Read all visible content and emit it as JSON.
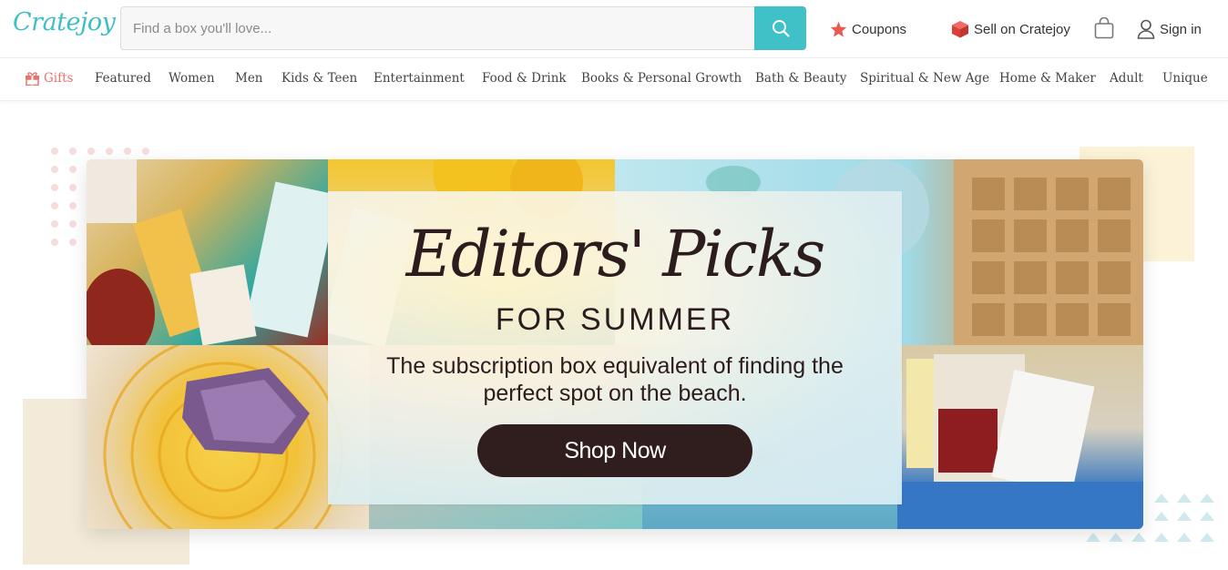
{
  "header": {
    "logo_text": "Cratejoy",
    "search": {
      "placeholder": "Find a box you'll love..."
    },
    "coupons_label": "Coupons",
    "sell_label": "Sell on Cratejoy",
    "signin_label": "Sign in",
    "icons": [
      "search-icon",
      "star-icon",
      "box-icon",
      "bag-icon",
      "user-icon"
    ]
  },
  "nav": {
    "items": [
      {
        "label": "Gifts"
      },
      {
        "label": "Featured"
      },
      {
        "label": "Women"
      },
      {
        "label": "Men"
      },
      {
        "label": "Kids & Teen"
      },
      {
        "label": "Entertainment"
      },
      {
        "label": "Food & Drink"
      },
      {
        "label": "Books & Personal Growth"
      },
      {
        "label": "Bath & Beauty"
      },
      {
        "label": "Spiritual & New Age"
      },
      {
        "label": "Home & Maker"
      },
      {
        "label": "Adult"
      },
      {
        "label": "Unique"
      }
    ]
  },
  "hero": {
    "title": "Editors' Picks",
    "subtitle": "FOR SUMMER",
    "description": "The subscription box equivalent of finding the perfect spot on the beach.",
    "cta_label": "Shop Now"
  },
  "colors": {
    "brand_teal": "#40c1c7",
    "gifts_accent": "#e8736d",
    "cta_dark": "#301e1e"
  }
}
